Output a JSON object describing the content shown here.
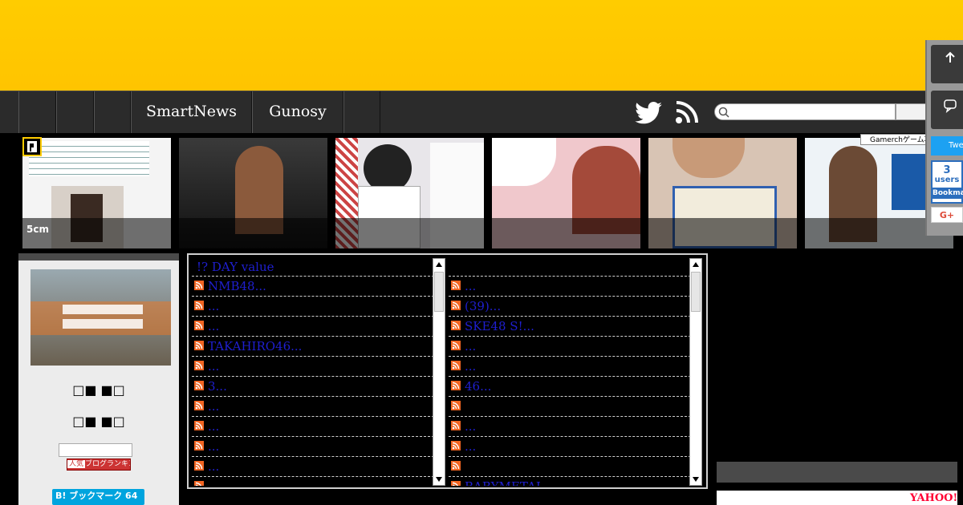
{
  "nav": {
    "items": [
      "",
      "",
      "",
      "SmartNews",
      "Gunosy",
      ""
    ]
  },
  "search": {
    "placeholder": ""
  },
  "thumbnails": [
    {
      "caption": "5cm"
    },
    {
      "caption": ""
    },
    {
      "caption": ""
    },
    {
      "caption": ""
    },
    {
      "caption": ""
    },
    {
      "caption": ""
    }
  ],
  "gamerch": {
    "label": "Gamerchゲーム攻略Wiki"
  },
  "side_widget": {
    "tweet_label": "Twe",
    "hatena_count": "3",
    "hatena_users": "users",
    "hatena_bookmark": "Bookmar",
    "gplus": "G+"
  },
  "sidebar": {
    "line1": "□■ ■□",
    "line2": "□■ ■□",
    "ranking_part1": "人気",
    "ranking_part2": "ブログランキング",
    "bookmark_label": "B! ブックマーク 64"
  },
  "feed_left": {
    "header": "!? DAY value",
    "items": [
      "NMB48...",
      "...",
      "...",
      "TAKAHIRO46...",
      "...",
      "3...",
      "...",
      "...",
      "...",
      "...",
      "...",
      "47..."
    ]
  },
  "feed_right": {
    "header": "",
    "items": [
      "...",
      "(39)...",
      "SKE48 S!...",
      "...",
      "...",
      "46...",
      "",
      "...",
      "...",
      "",
      "BABYMETAL...",
      ""
    ]
  },
  "ads": {
    "yahoo": "YAHOO!"
  },
  "colors": {
    "banner": "#ffcc00",
    "link": "#1f1fd0",
    "navbar": "#2b2b2b"
  }
}
